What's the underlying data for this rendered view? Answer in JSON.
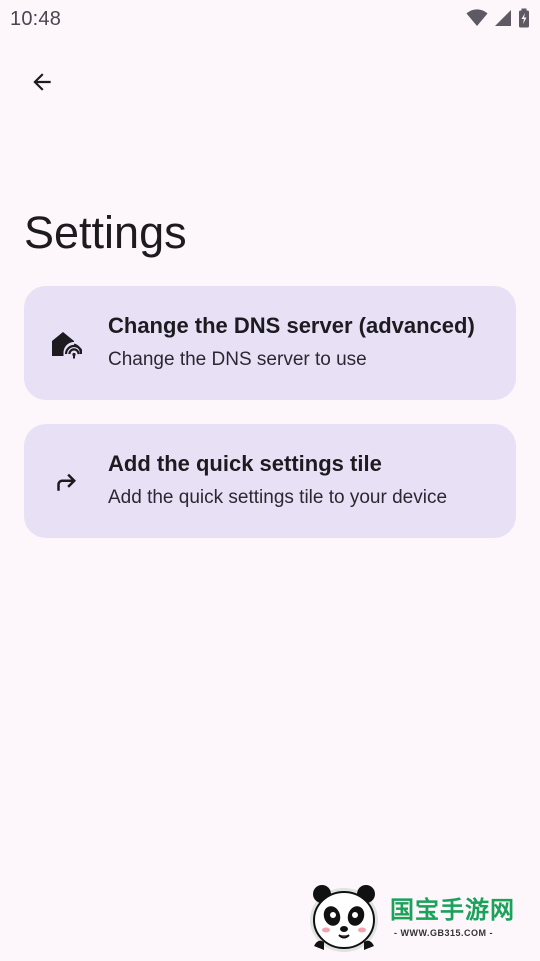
{
  "status_bar": {
    "time": "10:48",
    "icons": [
      "wifi-icon",
      "cell-signal-icon",
      "battery-charging-icon"
    ]
  },
  "app_bar": {
    "back_icon": "arrow-back-icon"
  },
  "page": {
    "title": "Settings"
  },
  "settings": [
    {
      "icon": "home-signal-icon",
      "title": "Change the DNS server (advanced)",
      "subtitle": "Change the DNS server to use"
    },
    {
      "icon": "redo-arrow-icon",
      "title": "Add the quick settings tile",
      "subtitle": "Add the quick settings tile to your device"
    }
  ],
  "watermark": {
    "title": "国宝手游网",
    "subtitle": "- WWW.GB315.COM -"
  },
  "colors": {
    "background": "#fdf7fc",
    "card": "#e8e0f5",
    "text": "#1d1b20",
    "watermark_green": "#1aa15a"
  }
}
